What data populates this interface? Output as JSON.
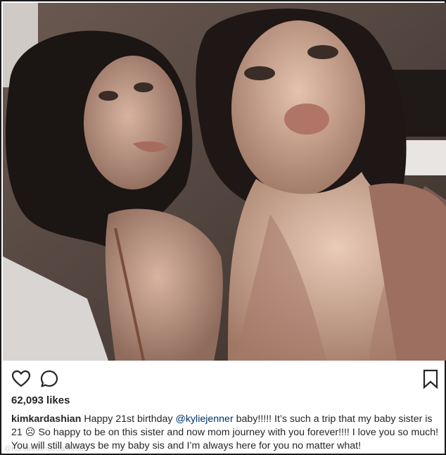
{
  "post": {
    "likes_text": "62,093 likes",
    "caption": {
      "username": "kimkardashian",
      "text_part1": " Happy 21st birthday ",
      "mention": "@kyliejenner",
      "text_part2": " baby!!!!! It’s such a trip that my baby sister is 21 ☹ So happy to be on this sister and now mom journey with you forever!!!! I love you so much! You will still always be my baby sis and I’m always here for you no matter what!"
    }
  },
  "icons": {
    "like": "heart-icon",
    "comment": "comment-icon",
    "save": "bookmark-icon"
  },
  "watermark": "@KardashianSocialMedia",
  "colors": {
    "text": "#262626",
    "mention": "#003569",
    "border": "#1a1a1a"
  }
}
